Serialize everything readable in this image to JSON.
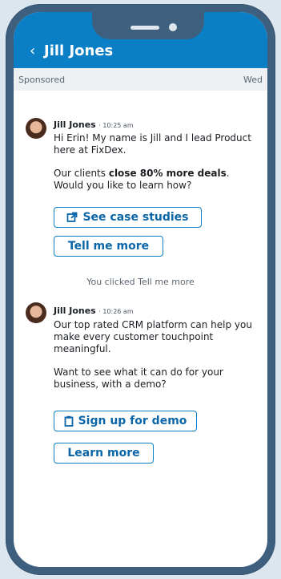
{
  "header": {
    "back_glyph": "‹",
    "title": "Jill Jones"
  },
  "meta": {
    "left": "Sponsored",
    "right": "Wed"
  },
  "messages": [
    {
      "sender": "Jill Jones",
      "time": "· 10:25 am",
      "lines": [
        "Hi Erin! My name is Jill and I lead Product here at FixDex.",
        {
          "before": "Our clients ",
          "bold": "close 80% more deals",
          "after": ". Would you like to learn how?"
        }
      ],
      "buttons": [
        {
          "label": "See case studies",
          "icon": "external-link-icon"
        },
        {
          "label": "Tell me more",
          "icon": ""
        }
      ]
    },
    {
      "sender": "Jill Jones",
      "time": "· 10:26 am",
      "lines": [
        "Our top rated CRM platform can help you make every customer touchpoint meaningful.",
        "Want to see what it can do for your business, with a demo?"
      ],
      "buttons": [
        {
          "label": "Sign up for demo",
          "icon": "clipboard-icon"
        },
        {
          "label": "Learn more",
          "icon": ""
        }
      ]
    }
  ],
  "note": "You clicked Tell me more",
  "colors": {
    "accent": "#0a7fc5",
    "frame": "#3f5f7f",
    "background": "#dbe6ef"
  }
}
